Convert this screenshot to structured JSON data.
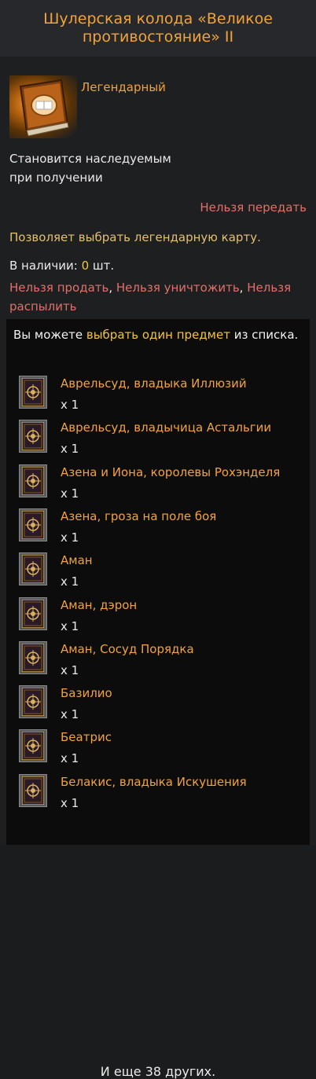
{
  "title": "Шулерская колода «Великое противостояние» II",
  "item": {
    "icon": "card-pack-book-icon",
    "grade": "Легендарный"
  },
  "bound_line1": "Становится наследуемым",
  "bound_line2": "при получении",
  "no_trade": "Нельзя передать",
  "description": "Позволяет выбрать легендарную карту.",
  "stock": {
    "label": "В наличии: ",
    "count": "0",
    "unit": " шт."
  },
  "restrictions": {
    "no_sell": "Нельзя продать",
    "no_destroy": "Нельзя уничтожить",
    "no_disassemble": "Нельзя распылить",
    "separator": ", "
  },
  "choose": {
    "prefix": "Вы можете ",
    "highlight": "выбрать один предмет",
    "suffix": " из списка."
  },
  "rewards": [
    {
      "name": "Аврельсуд, владыка Иллюзий",
      "qty": "x 1"
    },
    {
      "name": "Аврельсуд, владычица Астальгии",
      "qty": "x 1"
    },
    {
      "name": "Азена и Иона, королевы Рохэнделя",
      "qty": "x 1"
    },
    {
      "name": "Азена, гроза на поле боя",
      "qty": "x 1"
    },
    {
      "name": "Аман",
      "qty": "x 1"
    },
    {
      "name": "Аман, дэрон",
      "qty": "x 1"
    },
    {
      "name": "Аман, Сосуд Порядка",
      "qty": "x 1"
    },
    {
      "name": "Базилио",
      "qty": "x 1"
    },
    {
      "name": "Беатрис",
      "qty": "x 1"
    },
    {
      "name": "Белакис, владыка Искушения",
      "qty": "x 1"
    }
  ],
  "more": "И еще 38 других.",
  "colors": {
    "legendary": "#f2a33a",
    "warning": "#e0706a",
    "highlight": "#f2c53d",
    "description": "#e2c06e"
  }
}
